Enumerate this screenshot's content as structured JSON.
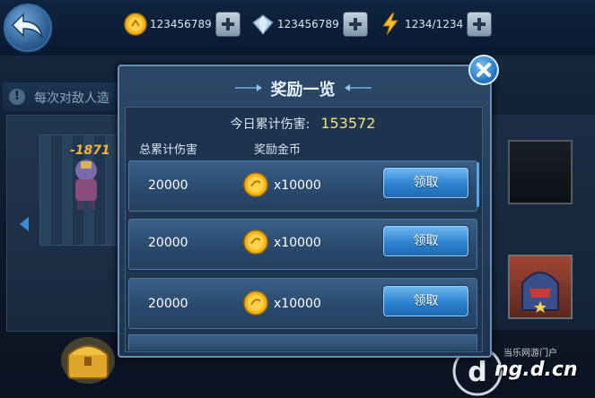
{
  "resources": {
    "gold": {
      "icon": "gold-coin-icon",
      "value": "123456789"
    },
    "diamond": {
      "icon": "diamond-icon",
      "value": "123456789"
    },
    "energy": {
      "icon": "lightning-icon",
      "value": "1234/1234"
    }
  },
  "hint": {
    "text": "每次对敌人造"
  },
  "battle": {
    "damage_popup": "-1871"
  },
  "modal": {
    "title": "奖励一览",
    "today_label": "今日累计伤害:",
    "today_value": "153572",
    "col_total_damage": "总累计伤害",
    "col_reward_gold": "奖励金币",
    "rows": [
      {
        "damage": "20000",
        "reward": "x10000",
        "button": "领取"
      },
      {
        "damage": "20000",
        "reward": "x10000",
        "button": "领取"
      },
      {
        "damage": "20000",
        "reward": "x10000",
        "button": "领取"
      }
    ]
  },
  "watermark": {
    "text": "当乐网游门户",
    "domain": "ng.d.cn"
  },
  "colors": {
    "accent": "#2d83cf",
    "gold_text": "#f5e27a",
    "modal_border": "#6b8fb5"
  }
}
